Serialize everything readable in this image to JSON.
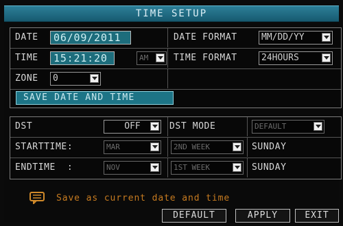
{
  "title": "TIME SETUP",
  "date_time": {
    "date_label": "DATE",
    "date_value": "06/09/2011",
    "time_label": "TIME",
    "time_value": "15:21:20",
    "ampm_value": "AM",
    "zone_label": "ZONE",
    "zone_value": "0",
    "date_format_label": "DATE FORMAT",
    "date_format_value": "MM/DD/YY",
    "time_format_label": "TIME FORMAT",
    "time_format_value": "24HOURS",
    "save_label": "SAVE DATE AND TIME"
  },
  "dst": {
    "dst_label": "DST",
    "dst_value": "OFF",
    "mode_label": "DST MODE",
    "mode_value": "DEFAULT",
    "start_label": "STARTTIME:",
    "start_month": "MAR",
    "start_week": "2ND WEEK",
    "start_day": "SUNDAY",
    "end_label": "ENDTIME  :",
    "end_month": "NOV",
    "end_week": "1ST WEEK",
    "end_day": "SUNDAY"
  },
  "message": "Save as current date and time",
  "footer": {
    "default_label": "DEFAULT",
    "apply_label": "APPLY",
    "exit_label": "EXIT"
  },
  "colors": {
    "title_bar": "#1f6f86",
    "selected_field": "#1d6d7c",
    "message_text": "#c77b20",
    "background": "#0a0a0a"
  }
}
